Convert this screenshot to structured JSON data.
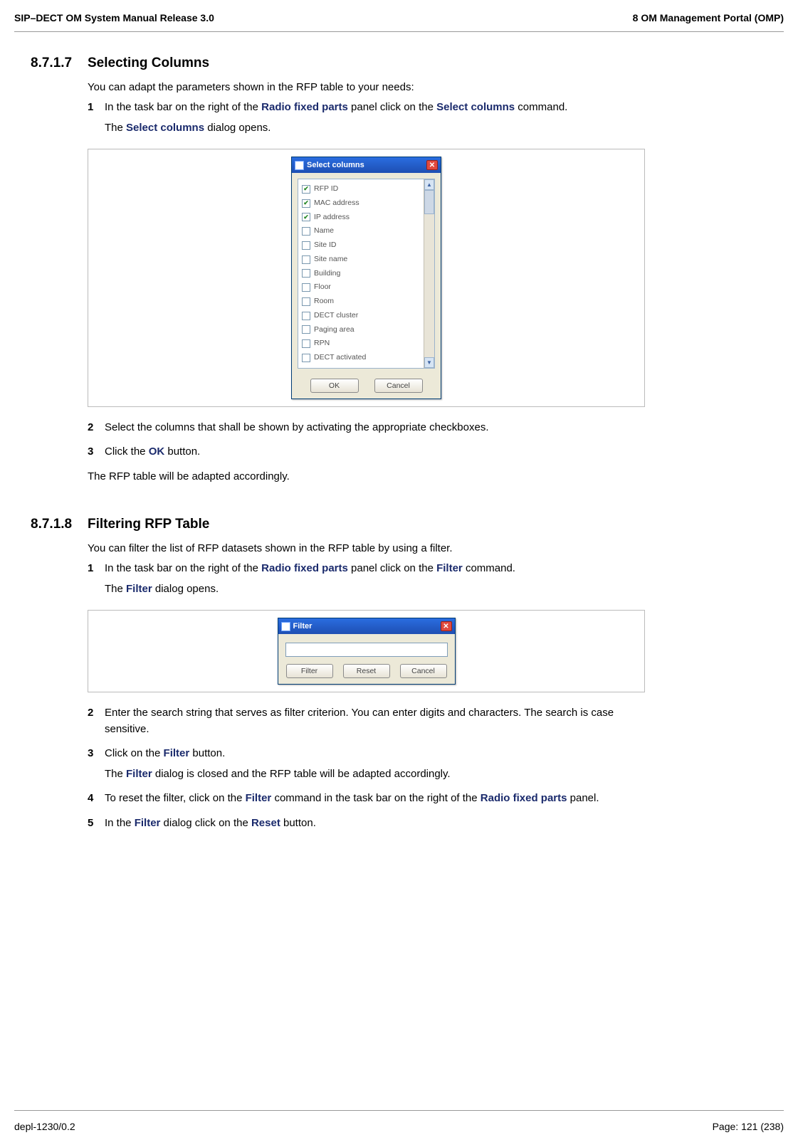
{
  "header": {
    "left": "SIP–DECT OM System Manual Release 3.0",
    "right": "8 OM Management Portal (OMP)"
  },
  "s1": {
    "num": "8.7.1.7",
    "title": "Selecting Columns",
    "intro": "You can adapt the parameters shown in the RFP table to your needs:",
    "step1_pre": "In the task bar on the right of the ",
    "step1_term1": "Radio fixed parts",
    "step1_mid": " panel click on the ",
    "step1_term2": "Select columns",
    "step1_post": " command.",
    "step1b_pre": "The ",
    "step1b_term": "Select columns",
    "step1b_post": " dialog opens.",
    "step2": "Select the columns that shall be shown by activating the appropriate checkboxes.",
    "step3_pre": "Click the ",
    "step3_term": "OK",
    "step3_post": " button.",
    "result": "The RFP table will be adapted accordingly."
  },
  "dlg_sc": {
    "title": "Select columns",
    "items": [
      {
        "label": "RFP ID",
        "checked": true
      },
      {
        "label": "MAC address",
        "checked": true
      },
      {
        "label": "IP address",
        "checked": true
      },
      {
        "label": "Name",
        "checked": false
      },
      {
        "label": "Site ID",
        "checked": false
      },
      {
        "label": "Site name",
        "checked": false
      },
      {
        "label": "Building",
        "checked": false
      },
      {
        "label": "Floor",
        "checked": false
      },
      {
        "label": "Room",
        "checked": false
      },
      {
        "label": "DECT cluster",
        "checked": false
      },
      {
        "label": "Paging area",
        "checked": false
      },
      {
        "label": "RPN",
        "checked": false
      },
      {
        "label": "DECT activated",
        "checked": false
      }
    ],
    "ok": "OK",
    "cancel": "Cancel"
  },
  "s2": {
    "num": "8.7.1.8",
    "title": "Filtering RFP Table",
    "intro": "You can filter the list of RFP datasets shown in the RFP table by using a filter.",
    "step1_pre": "In the task bar on the right of the ",
    "step1_term1": "Radio fixed parts",
    "step1_mid": " panel click on the ",
    "step1_term2": "Filter",
    "step1_post": " command.",
    "step1b_pre": "The ",
    "step1b_term": "Filter",
    "step1b_post": " dialog opens.",
    "step2": "Enter the search string that serves as filter criterion. You can enter digits and characters. The search is case sensitive.",
    "step3_pre": "Click on the ",
    "step3_term": "Filter",
    "step3_post": " button.",
    "step3b_pre": "The ",
    "step3b_term": "Filter",
    "step3b_post": " dialog is closed and the RFP table will be adapted accordingly.",
    "step4_pre": "To reset the filter, click on the ",
    "step4_term1": "Filter",
    "step4_mid": " command in the task bar on the right of the ",
    "step4_term2": "Radio fixed parts",
    "step4_post": " panel.",
    "step5_pre": "In the ",
    "step5_term1": "Filter",
    "step5_mid": " dialog click on the ",
    "step5_term2": "Reset",
    "step5_post": " button."
  },
  "dlg_f": {
    "title": "Filter",
    "filter": "Filter",
    "reset": "Reset",
    "cancel": "Cancel"
  },
  "footer": {
    "left": "depl-1230/0.2",
    "right": "Page: 121 (238)"
  },
  "nums": {
    "n1": "1",
    "n2": "2",
    "n3": "3",
    "n4": "4",
    "n5": "5"
  },
  "glyph": {
    "check": "✔",
    "close": "✕",
    "up": "▲",
    "down": "▼"
  }
}
